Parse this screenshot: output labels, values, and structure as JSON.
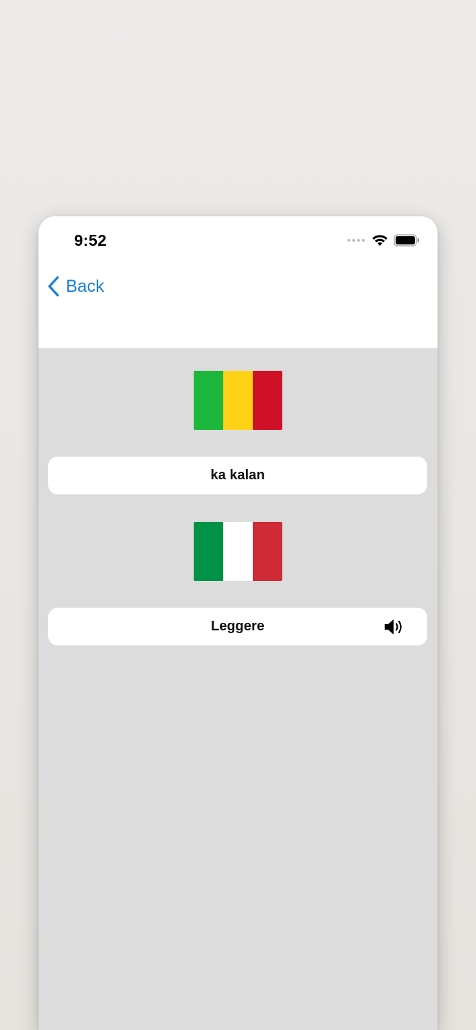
{
  "status_bar": {
    "time": "9:52"
  },
  "nav": {
    "back_label": "Back"
  },
  "source": {
    "flag_name": "mali-flag",
    "flag_colors": [
      "#1cb73c",
      "#fcd116",
      "#ce1126"
    ],
    "text": "ka kalan"
  },
  "target": {
    "flag_name": "italy-flag",
    "flag_colors": [
      "#009246",
      "#ffffff",
      "#ce2b37"
    ],
    "text": "Leggere",
    "icon": "speaker-icon"
  },
  "colors": {
    "accent": "#1a7fe0",
    "content_background": "#dcdcdd",
    "card_background": "#ffffff"
  }
}
